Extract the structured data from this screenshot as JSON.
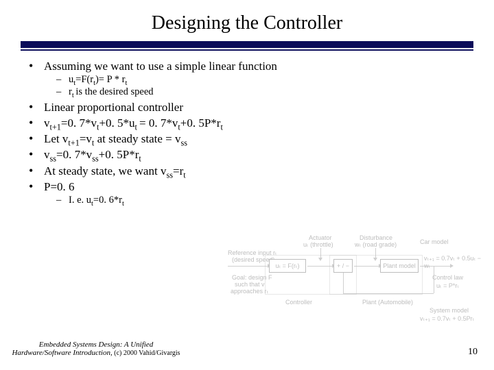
{
  "slide": {
    "title": "Designing the Controller",
    "bullets": {
      "b1": "Assuming we want to use a simple linear function",
      "b1_sub1_pre": "u",
      "b1_sub1_s1": "t",
      "b1_sub1_mid1": "=F(r",
      "b1_sub1_s2": "t",
      "b1_sub1_mid2": ")= P * r",
      "b1_sub1_s3": "t",
      "b1_sub2_pre": "r",
      "b1_sub2_s1": "t ",
      "b1_sub2_post": "is the desired speed",
      "b2": "Linear proportional controller",
      "b3_pre": "v",
      "b3_s1": "t+1",
      "b3_m1": "=0. 7*v",
      "b3_s2": "t",
      "b3_m2": "+0. 5*u",
      "b3_s3": "t ",
      "b3_m3": "= 0. 7*v",
      "b3_s4": "t",
      "b3_m4": "+0. 5P*r",
      "b3_s5": "t",
      "b4_pre": "Let v",
      "b4_s1": "t+1",
      "b4_m1": "=v",
      "b4_s2": "t",
      "b4_m2": " at steady state = v",
      "b4_s3": "ss",
      "b5_pre": "v",
      "b5_s1": "ss",
      "b5_m1": "=0. 7*v",
      "b5_s2": "ss",
      "b5_m2": "+0. 5P*r",
      "b5_s3": "t",
      "b6_pre": "At steady state, we want v",
      "b6_s1": "ss",
      "b6_m1": "=r",
      "b6_s2": "t",
      "b7": "P=0. 6",
      "b7_sub_pre": "I. e. u",
      "b7_sub_s1": "t",
      "b7_sub_m1": "=0. 6*r",
      "b7_sub_s2": "t"
    },
    "diagram": {
      "actuator_top": "Actuator",
      "actuator_sub": "uₜ (throttle)",
      "disturbance_top": "Disturbance",
      "disturbance_sub": "wₜ (road grade)",
      "carmodel": "Car model",
      "ref_top": "Reference input rₜ",
      "ref_sub": "(desired speed)",
      "fbox": "uₜ = F(rₜ)",
      "sumbox": "+ / −",
      "plantmodel": "Plant model",
      "eq1": "vₜ₊₁ = 0.7vₜ + 0.5uₜ − wₜ",
      "controllaw": "Control law",
      "uprt": "uₜ = P*rₜ",
      "goal1": "Goal: design F",
      "goal2": "such that v",
      "goal3": "approaches rₜ",
      "controller": "Controller",
      "plant": "Plant (Automobile)",
      "syslabel": "System model",
      "syseq": "vₜ₊₁ = 0.7vₜ + 0.5Prₜ"
    },
    "footer": {
      "credit_line1": "Embedded Systems Design: A Unified",
      "credit_line2": "Hardware/Software Introduction,",
      "credit_copy": " (c) 2000 Vahid/Givargis",
      "pagenum": "10"
    }
  }
}
